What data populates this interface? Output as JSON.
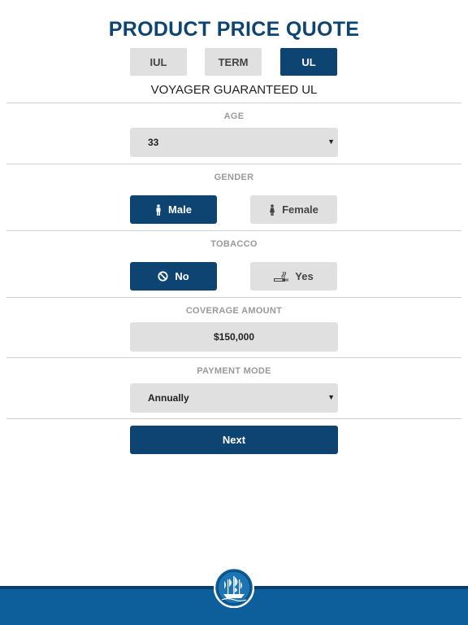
{
  "header": {
    "title": "PRODUCT PRICE QUOTE"
  },
  "tabs": [
    {
      "label": "IUL",
      "active": false
    },
    {
      "label": "TERM",
      "active": false
    },
    {
      "label": "UL",
      "active": true
    }
  ],
  "product_name": "VOYAGER GUARANTEED UL",
  "age": {
    "label": "AGE",
    "value": "33"
  },
  "gender": {
    "label": "GENDER",
    "options": [
      {
        "label": "Male",
        "icon": "male-icon",
        "selected": true
      },
      {
        "label": "Female",
        "icon": "female-icon",
        "selected": false
      }
    ]
  },
  "tobacco": {
    "label": "TOBACCO",
    "options": [
      {
        "label": "No",
        "icon": "no-smoking-icon",
        "selected": true
      },
      {
        "label": "Yes",
        "icon": "cigarette-icon",
        "selected": false
      }
    ]
  },
  "coverage": {
    "label": "COVERAGE AMOUNT",
    "value": "$150,000"
  },
  "payment_mode": {
    "label": "PAYMENT MODE",
    "value": "Annually"
  },
  "next_label": "Next",
  "colors": {
    "primary": "#0d4472",
    "footer": "#0d5f9c",
    "control_bg": "#e0e0e0",
    "label_gray": "#9a9a9a"
  },
  "footer": {
    "logo_icon": "ship-logo-icon"
  }
}
